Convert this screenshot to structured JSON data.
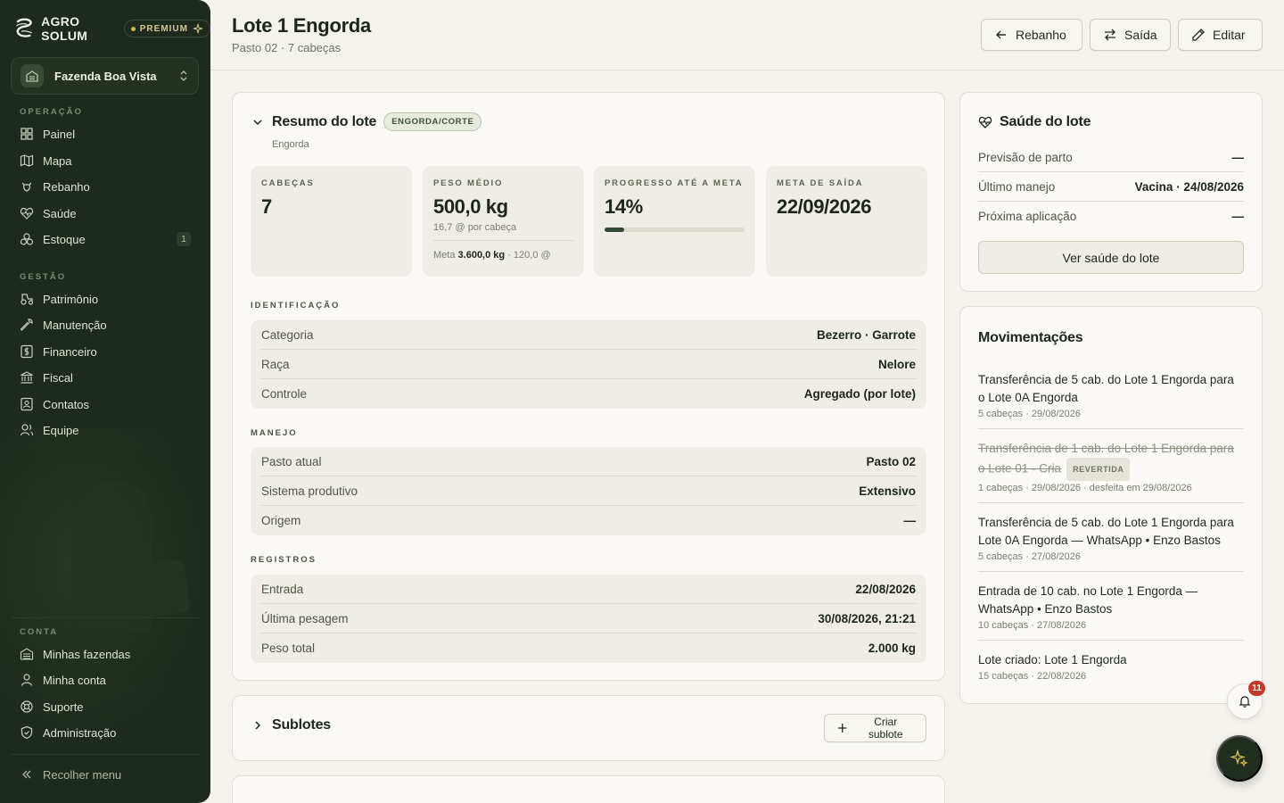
{
  "brand": {
    "name": "AGRO SOLUM",
    "badge": "PREMIUM"
  },
  "farm": {
    "name": "Fazenda Boa Vista"
  },
  "nav": {
    "operacao_label": "OPERAÇÃO",
    "operacao": [
      {
        "label": "Painel",
        "icon": "grid-icon"
      },
      {
        "label": "Mapa",
        "icon": "map-icon"
      },
      {
        "label": "Rebanho",
        "icon": "cattle-icon"
      },
      {
        "label": "Saúde",
        "icon": "heart-pulse-icon"
      },
      {
        "label": "Estoque",
        "icon": "boxes-icon",
        "badge": "1"
      }
    ],
    "gestao_label": "GESTÃO",
    "gestao": [
      {
        "label": "Patrimônio",
        "icon": "tractor-icon"
      },
      {
        "label": "Manutenção",
        "icon": "wrench-icon"
      },
      {
        "label": "Financeiro",
        "icon": "dollar-icon"
      },
      {
        "label": "Fiscal",
        "icon": "bank-icon"
      },
      {
        "label": "Contatos",
        "icon": "contacts-icon"
      },
      {
        "label": "Equipe",
        "icon": "users-icon"
      }
    ],
    "conta_label": "CONTA",
    "conta": [
      {
        "label": "Minhas fazendas",
        "icon": "warehouse-icon"
      },
      {
        "label": "Minha conta",
        "icon": "user-icon"
      },
      {
        "label": "Suporte",
        "icon": "lifebuoy-icon"
      },
      {
        "label": "Administração",
        "icon": "shield-check-icon"
      }
    ],
    "collapse_label": "Recolher menu"
  },
  "header": {
    "title": "Lote 1 Engorda",
    "subtitle": "Pasto 02 · 7 cabeças",
    "btn_rebanho": "Rebanho",
    "btn_saida": "Saída",
    "btn_editar": "Editar"
  },
  "resumo": {
    "title": "Resumo do lote",
    "tag": "ENGORDA/CORTE",
    "subtitle": "Engorda",
    "stats": {
      "cabecas_label": "CABEÇAS",
      "cabecas_value": "7",
      "peso_label": "PESO MÉDIO",
      "peso_value": "500,0 kg",
      "peso_note": "16,7 @ por cabeça",
      "peso_meta_prefix": "Meta",
      "peso_meta_value": "3.600,0 kg",
      "peso_meta_suffix": "· 120,0 @",
      "progresso_label": "PROGRESSO ATÉ A META",
      "progresso_value": "14%",
      "progresso_fraction": 0.14,
      "meta_label": "META DE SAÍDA",
      "meta_value": "22/09/2026"
    },
    "identificacao_label": "IDENTIFICAÇÃO",
    "identificacao": [
      {
        "key": "Categoria",
        "value": "Bezerro · Garrote"
      },
      {
        "key": "Raça",
        "value": "Nelore"
      },
      {
        "key": "Controle",
        "value": "Agregado (por lote)"
      }
    ],
    "manejo_label": "MANEJO",
    "manejo": [
      {
        "key": "Pasto atual",
        "value": "Pasto 02"
      },
      {
        "key": "Sistema produtivo",
        "value": "Extensivo"
      },
      {
        "key": "Origem",
        "value": "—"
      }
    ],
    "registros_label": "REGISTROS",
    "registros": [
      {
        "key": "Entrada",
        "value": "22/08/2026"
      },
      {
        "key": "Última pesagem",
        "value": "30/08/2026, 21:21"
      },
      {
        "key": "Peso total",
        "value": "2.000 kg"
      }
    ]
  },
  "sublotes": {
    "title": "Sublotes",
    "btn": "Criar sublote"
  },
  "saude": {
    "title": "Saúde do lote",
    "rows": [
      {
        "key": "Previsão de parto",
        "value": "—"
      },
      {
        "key": "Último manejo",
        "value": "Vacina · 24/08/2026"
      },
      {
        "key": "Próxima aplicação",
        "value": "—"
      }
    ],
    "btn": "Ver saúde do lote"
  },
  "movimentacoes": {
    "title": "Movimentações",
    "items": [
      {
        "text": "Transferência de 5 cab. do Lote 1 Engorda para o Lote 0A Engorda",
        "meta": "5 cabeças · 29/08/2026",
        "reverted": false
      },
      {
        "text": "Transferência de 1 cab. do Lote 1 Engorda para o Lote 01 - Cria",
        "meta": "1 cabeças · 29/08/2026 · desfeita em 29/08/2026",
        "reverted": true,
        "badge": "REVERTIDA"
      },
      {
        "text": "Transferência de 5 cab. do Lote 1 Engorda para Lote 0A Engorda — WhatsApp • Enzo Bastos",
        "meta": "5 cabeças · 27/08/2026",
        "reverted": false
      },
      {
        "text": "Entrada de 10 cab. no Lote 1 Engorda — WhatsApp • Enzo Bastos",
        "meta": "10 cabeças · 27/08/2026",
        "reverted": false
      },
      {
        "text": "Lote criado: Lote 1 Engorda",
        "meta": "15 cabeças · 22/08/2026",
        "reverted": false
      }
    ]
  },
  "notifications": {
    "count": "11"
  },
  "colors": {
    "sidebar": "#1e2a1e",
    "accent": "#2f4a2e",
    "danger": "#c23a2b",
    "background": "#f4f2ec"
  }
}
